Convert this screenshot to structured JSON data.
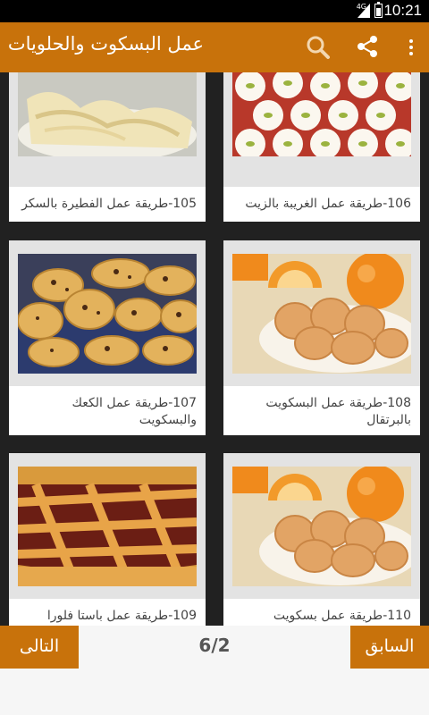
{
  "status_bar": {
    "network": "4G",
    "time": "10:21"
  },
  "app_bar": {
    "title": "عمل البسكوت والحلويات"
  },
  "recipes": [
    {
      "caption": "105-طريقة عمل الفطيرة بالسكر"
    },
    {
      "caption": "106-طريقة عمل الغريبة بالزيت"
    },
    {
      "caption": "107-طريقة عمل الكعك والبسكويت"
    },
    {
      "caption": "108-طريقة عمل البسكويت بالبرتقال"
    },
    {
      "caption": "109-طريقة عمل باستا فلورا"
    },
    {
      "caption": "110-طريقة عمل بسكويت"
    }
  ],
  "pagination": {
    "next_label": "التالى",
    "prev_label": "السابق",
    "page_indicator": "6/2"
  },
  "colors": {
    "accent": "#c8720b",
    "grid_bg": "#212121"
  }
}
